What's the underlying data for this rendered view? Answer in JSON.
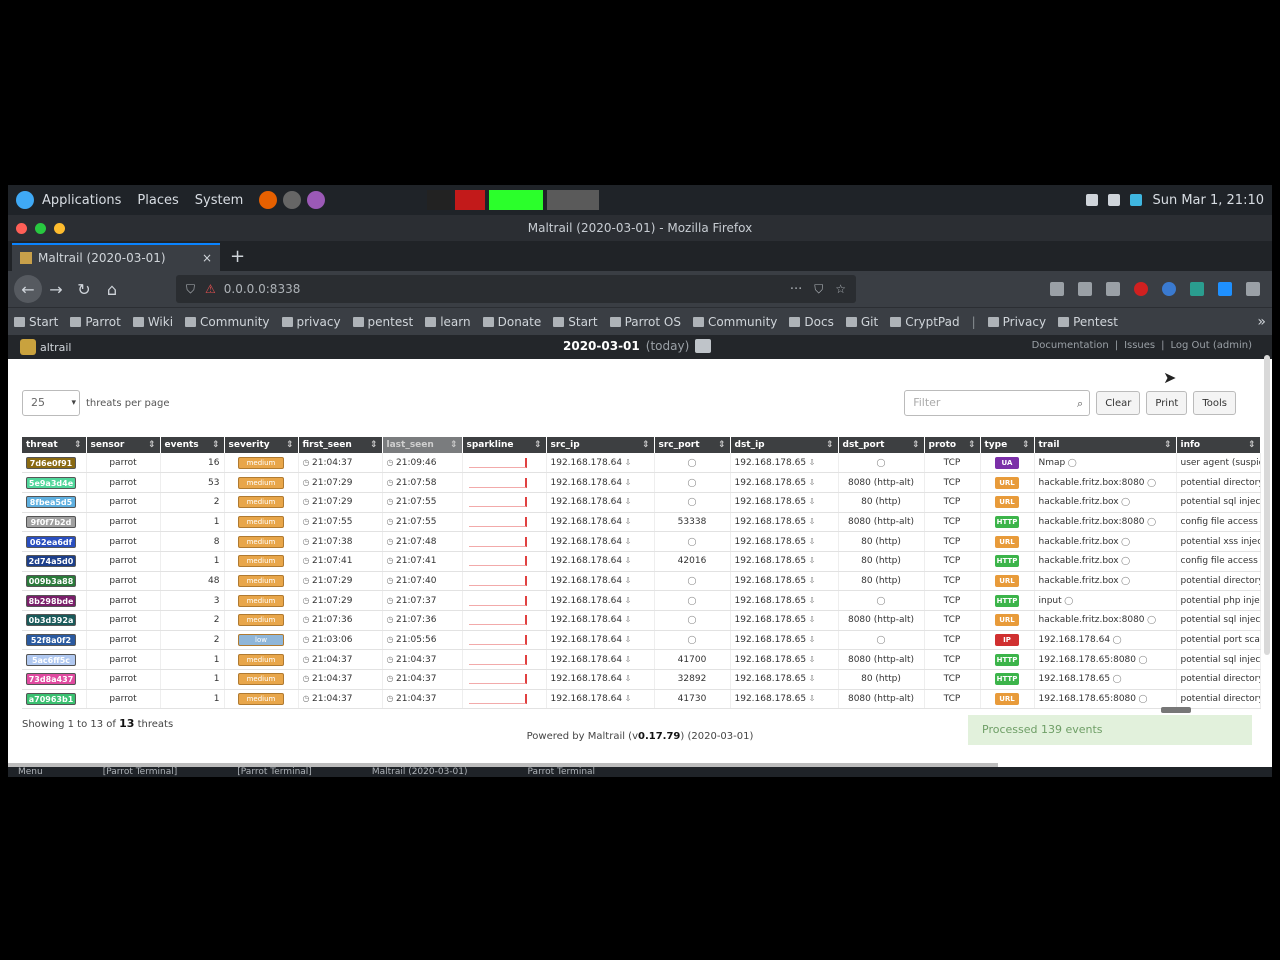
{
  "topbar": {
    "applications": "Applications",
    "places": "Places",
    "system": "System",
    "clock": "Sun Mar 1, 21:10"
  },
  "window": {
    "title": "Maltrail (2020-03-01) - Mozilla Firefox"
  },
  "tab": {
    "title": "Maltrail (2020-03-01)",
    "close": "×",
    "new": "+"
  },
  "nav": {
    "url": "0.0.0.0:8338",
    "more": "···"
  },
  "bookmarks": [
    "Start",
    "Parrot",
    "Wiki",
    "Community",
    "privacy",
    "pentest",
    "learn",
    "Donate",
    "Start",
    "Parrot OS",
    "Community",
    "Docs",
    "Git",
    "CryptPad",
    "Privacy",
    "Pentest"
  ],
  "bookmarks_more": "»",
  "app": {
    "logo": "altrail",
    "date": "2020-03-01",
    "today": "(today)",
    "links": [
      "Documentation",
      "Issues",
      "Log Out (admin)"
    ]
  },
  "controls": {
    "per_page_value": "25",
    "per_page_label": "threats per page",
    "filter_placeholder": "Filter",
    "clear": "Clear",
    "print": "Print",
    "tools": "Tools"
  },
  "columns": [
    "threat",
    "sensor",
    "events",
    "severity",
    "first_seen",
    "last_seen",
    "sparkline",
    "src_ip",
    "src_port",
    "dst_ip",
    "dst_port",
    "proto",
    "type",
    "trail",
    "info"
  ],
  "rows": [
    {
      "threat": "7d6e0f91",
      "tc": "#8a6a12",
      "sensor": "parrot",
      "events": "16",
      "sev": "medium",
      "sc": "#e8a64a",
      "first": "21:04:37",
      "last": "21:09:46",
      "src_ip": "192.168.178.64",
      "src_port": "",
      "dst_ip": "192.168.178.65",
      "dst_port": "",
      "proto": "TCP",
      "type": "UA",
      "tyc": "#7b2fa8",
      "trail": "Nmap",
      "info": "user agent (suspicious)"
    },
    {
      "threat": "5e9a3d4e",
      "tc": "#4fd69a",
      "sensor": "parrot",
      "events": "53",
      "sev": "medium",
      "sc": "#e8a64a",
      "first": "21:07:29",
      "last": "21:07:58",
      "src_ip": "192.168.178.64",
      "src_port": "",
      "dst_ip": "192.168.178.65",
      "dst_port": "8080 (http-alt)",
      "proto": "TCP",
      "type": "URL",
      "tyc": "#e89b3a",
      "trail": "hackable.fritz.box:8080",
      "info": "potential directory traversal"
    },
    {
      "threat": "8fbea5d5",
      "tc": "#5fb0e0",
      "sensor": "parrot",
      "events": "2",
      "sev": "medium",
      "sc": "#e8a64a",
      "first": "21:07:29",
      "last": "21:07:55",
      "src_ip": "192.168.178.64",
      "src_port": "",
      "dst_ip": "192.168.178.65",
      "dst_port": "80 (http)",
      "proto": "TCP",
      "type": "URL",
      "tyc": "#e89b3a",
      "trail": "hackable.fritz.box",
      "info": "potential sql injection"
    },
    {
      "threat": "9f0f7b2d",
      "tc": "#a0a0a0",
      "sensor": "parrot",
      "events": "1",
      "sev": "medium",
      "sc": "#e8a64a",
      "first": "21:07:55",
      "last": "21:07:55",
      "src_ip": "192.168.178.64",
      "src_port": "53338",
      "dst_ip": "192.168.178.65",
      "dst_port": "8080 (http-alt)",
      "proto": "TCP",
      "type": "HTTP",
      "tyc": "#3cb44a",
      "trail": "hackable.fritz.box:8080",
      "info": "config file access"
    },
    {
      "threat": "062ea6df",
      "tc": "#2a4fc0",
      "sensor": "parrot",
      "events": "8",
      "sev": "medium",
      "sc": "#e8a64a",
      "first": "21:07:38",
      "last": "21:07:48",
      "src_ip": "192.168.178.64",
      "src_port": "",
      "dst_ip": "192.168.178.65",
      "dst_port": "80 (http)",
      "proto": "TCP",
      "type": "URL",
      "tyc": "#e89b3a",
      "trail": "hackable.fritz.box",
      "info": "potential xss injection"
    },
    {
      "threat": "2d74a5d0",
      "tc": "#1d3f8a",
      "sensor": "parrot",
      "events": "1",
      "sev": "medium",
      "sc": "#e8a64a",
      "first": "21:07:41",
      "last": "21:07:41",
      "src_ip": "192.168.178.64",
      "src_port": "42016",
      "dst_ip": "192.168.178.65",
      "dst_port": "80 (http)",
      "proto": "TCP",
      "type": "HTTP",
      "tyc": "#3cb44a",
      "trail": "hackable.fritz.box",
      "info": "config file access"
    },
    {
      "threat": "009b3a88",
      "tc": "#2a7a3a",
      "sensor": "parrot",
      "events": "48",
      "sev": "medium",
      "sc": "#e8a64a",
      "first": "21:07:29",
      "last": "21:07:40",
      "src_ip": "192.168.178.64",
      "src_port": "",
      "dst_ip": "192.168.178.65",
      "dst_port": "80 (http)",
      "proto": "TCP",
      "type": "URL",
      "tyc": "#e89b3a",
      "trail": "hackable.fritz.box",
      "info": "potential directory traversal"
    },
    {
      "threat": "8b298bde",
      "tc": "#7a1f6a",
      "sensor": "parrot",
      "events": "3",
      "sev": "medium",
      "sc": "#e8a64a",
      "first": "21:07:29",
      "last": "21:07:37",
      "src_ip": "192.168.178.64",
      "src_port": "",
      "dst_ip": "192.168.178.65",
      "dst_port": "",
      "proto": "TCP",
      "type": "HTTP",
      "tyc": "#3cb44a",
      "trail": "input",
      "info": "potential php injection"
    },
    {
      "threat": "0b3d392a",
      "tc": "#1a5a5a",
      "sensor": "parrot",
      "events": "2",
      "sev": "medium",
      "sc": "#e8a64a",
      "first": "21:07:36",
      "last": "21:07:36",
      "src_ip": "192.168.178.64",
      "src_port": "",
      "dst_ip": "192.168.178.65",
      "dst_port": "8080 (http-alt)",
      "proto": "TCP",
      "type": "URL",
      "tyc": "#e89b3a",
      "trail": "hackable.fritz.box:8080",
      "info": "potential sql injection"
    },
    {
      "threat": "52f8a0f2",
      "tc": "#2a5aa0",
      "sensor": "parrot",
      "events": "2",
      "sev": "low",
      "sc": "#8fb6d9",
      "first": "21:03:06",
      "last": "21:05:56",
      "src_ip": "192.168.178.64",
      "src_port": "",
      "dst_ip": "192.168.178.65",
      "dst_port": "",
      "proto": "TCP",
      "type": "IP",
      "tyc": "#d03030",
      "trail": "192.168.178.64",
      "info": "potential port scanning"
    },
    {
      "threat": "5ac6ff5c",
      "tc": "#b0c8f0",
      "sensor": "parrot",
      "events": "1",
      "sev": "medium",
      "sc": "#e8a64a",
      "first": "21:04:37",
      "last": "21:04:37",
      "src_ip": "192.168.178.64",
      "src_port": "41700",
      "dst_ip": "192.168.178.65",
      "dst_port": "8080 (http-alt)",
      "proto": "TCP",
      "type": "HTTP",
      "tyc": "#3cb44a",
      "trail": "192.168.178.65:8080",
      "info": "potential sql injection"
    },
    {
      "threat": "73d8a437",
      "tc": "#e04aa0",
      "sensor": "parrot",
      "events": "1",
      "sev": "medium",
      "sc": "#e8a64a",
      "first": "21:04:37",
      "last": "21:04:37",
      "src_ip": "192.168.178.64",
      "src_port": "32892",
      "dst_ip": "192.168.178.65",
      "dst_port": "80 (http)",
      "proto": "TCP",
      "type": "HTTP",
      "tyc": "#3cb44a",
      "trail": "192.168.178.65",
      "info": "potential directory traversal"
    },
    {
      "threat": "a70963b1",
      "tc": "#3ac070",
      "sensor": "parrot",
      "events": "1",
      "sev": "medium",
      "sc": "#e8a64a",
      "first": "21:04:37",
      "last": "21:04:37",
      "src_ip": "192.168.178.64",
      "src_port": "41730",
      "dst_ip": "192.168.178.65",
      "dst_port": "8080 (http-alt)",
      "proto": "TCP",
      "type": "URL",
      "tyc": "#e89b3a",
      "trail": "192.168.178.65:8080",
      "info": "potential directory traversal"
    }
  ],
  "footer": {
    "showing": "Showing 1 to 13 of",
    "total": "13",
    "suffix": "threats",
    "processed": "Processed 139 events",
    "powered_prefix": "Powered by Maltrail (v",
    "powered_version": "0.17.79",
    "powered_suffix": ") (2020-03-01)"
  },
  "taskbar": [
    "Menu",
    "[Parrot Terminal]",
    "[Parrot Terminal]",
    "Maltrail (2020-03-01)",
    "Parrot Terminal"
  ],
  "colors": {
    "accent": "#0a84ff",
    "header": "#3d3f41",
    "severity_medium": "#e8a64a",
    "processed_bg": "#e2f1dc"
  }
}
